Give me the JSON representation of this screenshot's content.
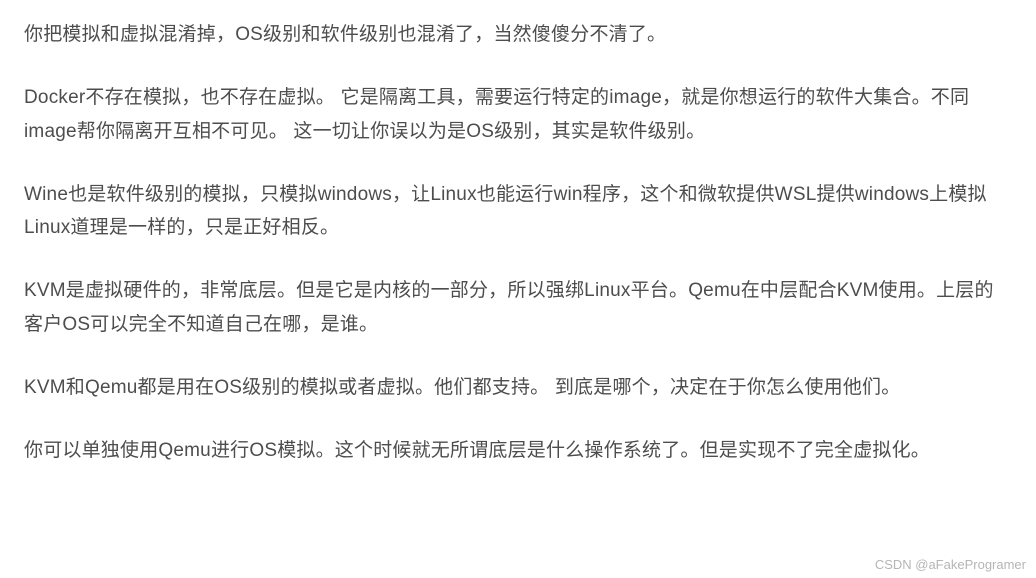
{
  "paragraphs": [
    "你把模拟和虚拟混淆掉，OS级别和软件级别也混淆了，当然傻傻分不清了。",
    "Docker不存在模拟，也不存在虚拟。 它是隔离工具，需要运行特定的image，就是你想运行的软件大集合。不同image帮你隔离开互相不可见。 这一切让你误以为是OS级别，其实是软件级别。",
    "Wine也是软件级别的模拟，只模拟windows，让Linux也能运行win程序，这个和微软提供WSL提供windows上模拟Linux道理是一样的，只是正好相反。",
    "KVM是虚拟硬件的，非常底层。但是它是内核的一部分，所以强绑Linux平台。Qemu在中层配合KVM使用。上层的客户OS可以完全不知道自己在哪，是谁。",
    "KVM和Qemu都是用在OS级别的模拟或者虚拟。他们都支持。 到底是哪个，决定在于你怎么使用他们。",
    "你可以单独使用Qemu进行OS模拟。这个时候就无所谓底层是什么操作系统了。但是实现不了完全虚拟化。"
  ],
  "watermark": "CSDN @aFakeProgramer"
}
